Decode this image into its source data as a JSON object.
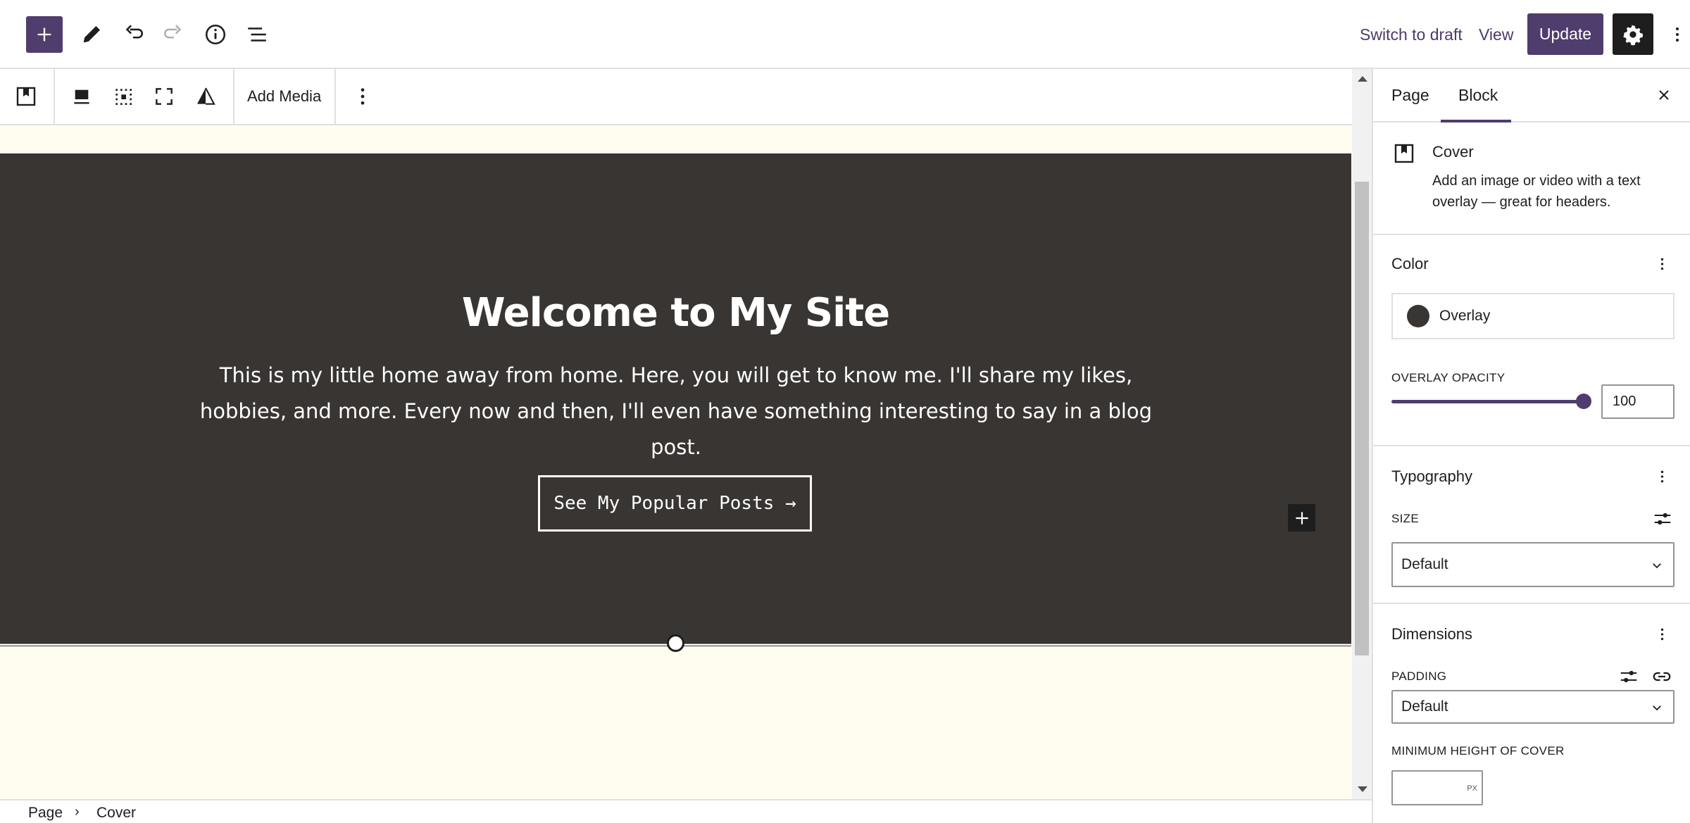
{
  "topbar": {
    "switch_to_draft": "Switch to draft",
    "view": "View",
    "update": "Update"
  },
  "block_toolbar": {
    "add_media": "Add Media"
  },
  "cover": {
    "title": "Welcome to My Site",
    "paragraph": "This is my little home away from home. Here, you will get to know me.  I'll share my likes, hobbies, and more.  Every now and then, I'll even have something interesting to say in a blog post.",
    "button": "See My Popular Posts →",
    "overlay_color": "#393533"
  },
  "breadcrumb": [
    "Page",
    "Cover"
  ],
  "sidebar": {
    "tabs": [
      "Page",
      "Block"
    ],
    "active_tab": "Block",
    "block": {
      "name": "Cover",
      "description": "Add an image or video with a text overlay — great for headers."
    },
    "color": {
      "title": "Color",
      "overlay_label": "Overlay",
      "opacity_label": "OVERLAY OPACITY",
      "opacity_value": "100"
    },
    "typography": {
      "title": "Typography",
      "size_label": "SIZE",
      "size_value": "Default"
    },
    "dimensions": {
      "title": "Dimensions",
      "padding_label": "PADDING",
      "padding_value": "Default",
      "min_height_label": "MINIMUM HEIGHT OF COVER",
      "min_height_unit": "PX"
    }
  },
  "colors": {
    "accent": "#4f3d6e",
    "canvas_background": "#fffdf0",
    "dark": "#1e1e1e"
  }
}
